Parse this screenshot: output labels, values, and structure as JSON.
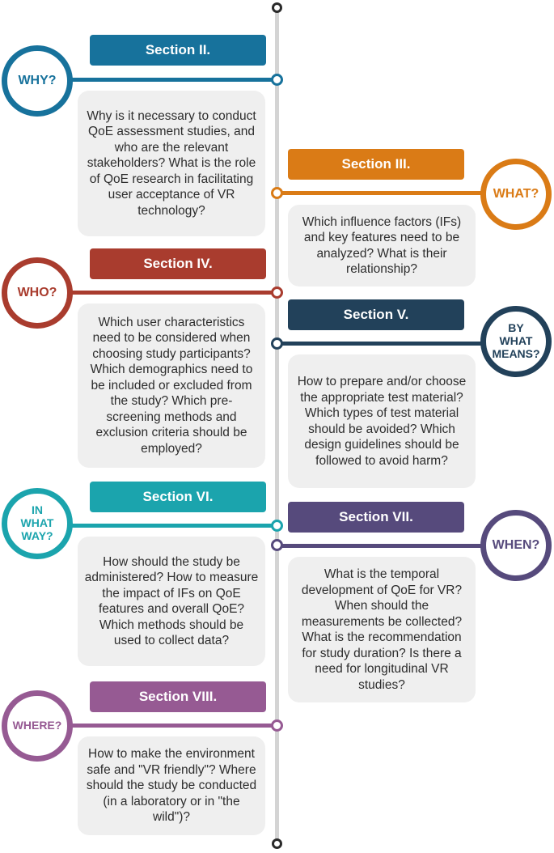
{
  "timeline": {
    "items": [
      {
        "section": "Section II.",
        "question": "WHY?",
        "color": "#17729c",
        "description": "Why is it necessary to conduct QoE assessment studies, and who are the relevant stakeholders? What is the role of QoE research in facilitating user acceptance of VR technology?"
      },
      {
        "section": "Section III.",
        "question": "WHAT?",
        "color": "#da7b16",
        "description": "Which influence factors (IFs) and key features need to be analyzed? What is their relationship?"
      },
      {
        "section": "Section IV.",
        "question": "WHO?",
        "color": "#a93c2e",
        "description": "Which user characteristics need to be considered when choosing study participants? Which demographics need to be included or excluded from the study? Which pre-screening methods and exclusion criteria should be employed?"
      },
      {
        "section": "Section V.",
        "question": "BY WHAT MEANS?",
        "color": "#22415a",
        "description": "How to prepare and/or choose the appropriate test material? Which types of test material should be avoided? Which design guidelines should be followed to avoid harm?"
      },
      {
        "section": "Section VI.",
        "question": "IN WHAT WAY?",
        "color": "#1ba4ad",
        "description": "How should the study be administered? How to measure the impact of IFs on QoE features and overall QoE? Which methods should be used to collect data?"
      },
      {
        "section": "Section VII.",
        "question": "WHEN?",
        "color": "#564a7c",
        "description": "What is the temporal development of QoE for VR? When should the measurements be collected? What is the recommendation for study duration? Is there a need for longitudinal VR studies?"
      },
      {
        "section": "Section VIII.",
        "question": "WHERE?",
        "color": "#965a93",
        "description": "How to make the environment safe and \"VR friendly\"? Where should the study be conducted (in a laboratory or in \"the wild\")?"
      }
    ]
  }
}
